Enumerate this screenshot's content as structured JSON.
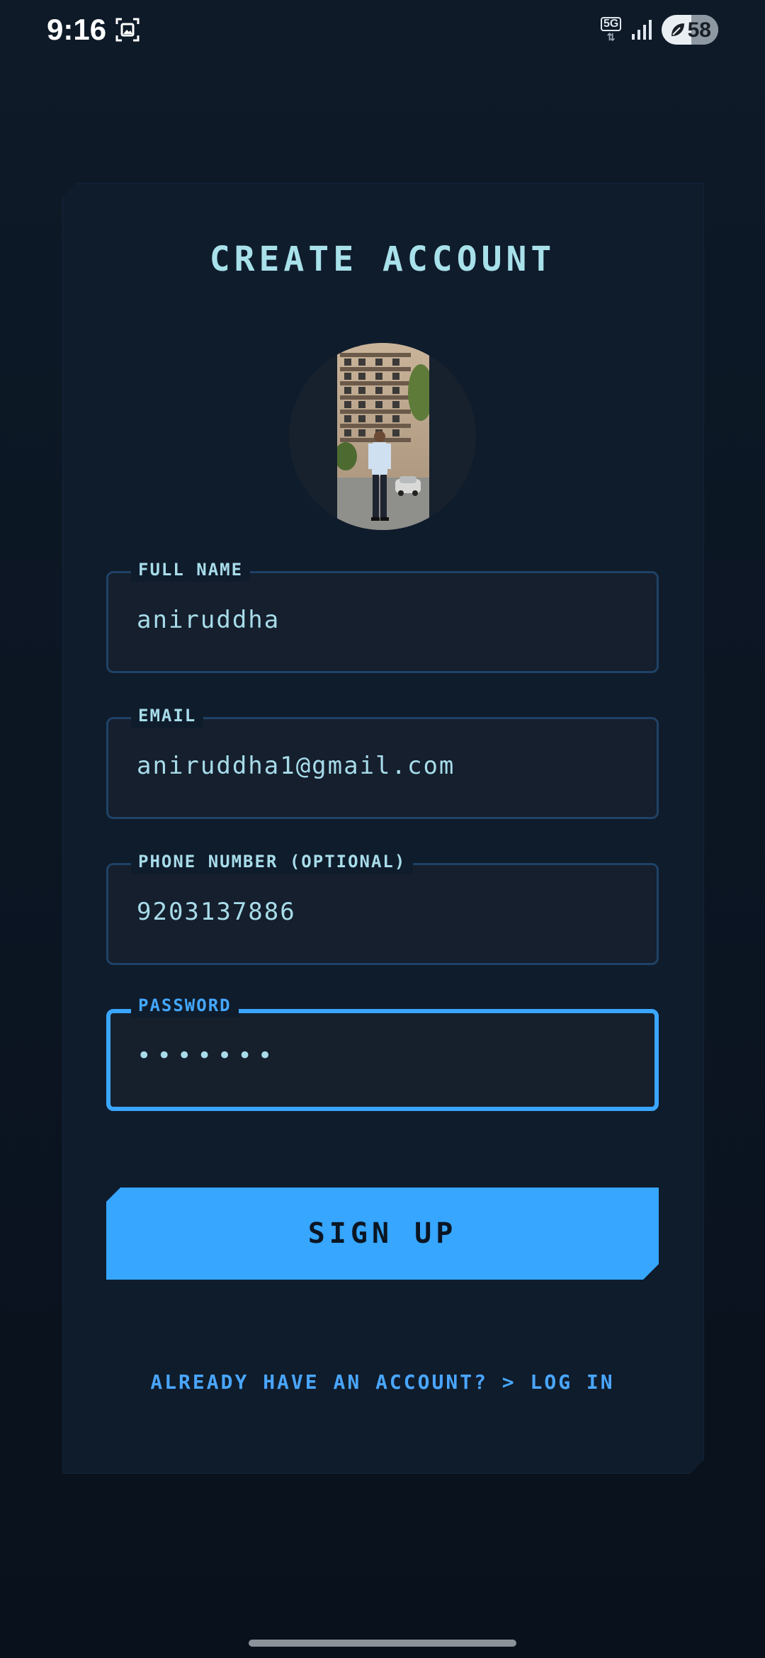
{
  "status_bar": {
    "time": "9:16",
    "network": "5G",
    "battery": "58",
    "icons": [
      "screenshot-icon",
      "signal-icon",
      "battery-saver-leaf-icon"
    ]
  },
  "form": {
    "title": "CREATE ACCOUNT",
    "fields": [
      {
        "label": "FULL NAME",
        "value": "aniruddha"
      },
      {
        "label": "EMAIL",
        "value": "aniruddha1@gmail.com"
      },
      {
        "label": "PHONE NUMBER (OPTIONAL)",
        "value": "9203137886"
      },
      {
        "label": "PASSWORD",
        "value": "•••••••",
        "focused": true
      }
    ],
    "submit_label": "SIGN UP",
    "login_prompt": "ALREADY HAVE AN ACCOUNT? > LOG IN"
  },
  "colors": {
    "background": "#0e1a28",
    "card": "#0f1c2c",
    "accent": "#36a6ff",
    "text": "#a8dcea",
    "field_border": "#1f4266"
  }
}
